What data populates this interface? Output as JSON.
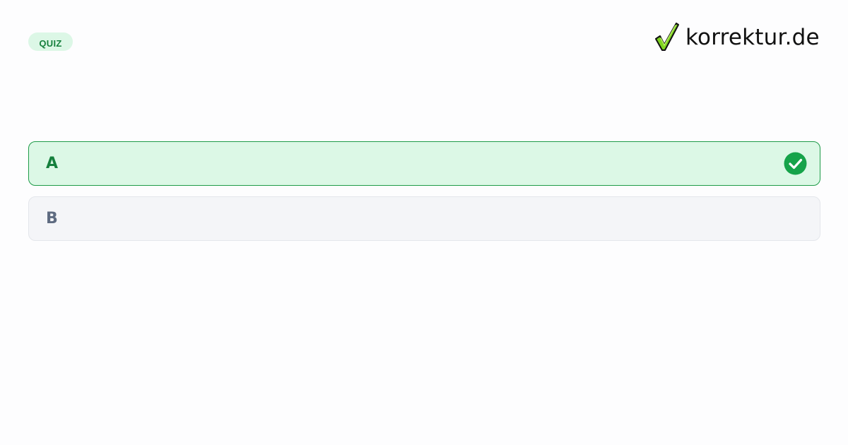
{
  "badge": {
    "label": "QUIZ"
  },
  "brand": {
    "name": "korrektur.de",
    "icon": "checkmark-logo-icon"
  },
  "options": [
    {
      "letter": "A",
      "state": "correct",
      "icon": "check-circle-icon"
    },
    {
      "letter": "B",
      "state": "neutral"
    }
  ],
  "colors": {
    "accent_green": "#16a34a",
    "correct_bg": "#dcf8e6",
    "correct_border": "#1e9b48",
    "neutral_bg": "#f4f5f8",
    "neutral_text": "#5e6b81",
    "badge_bg": "#dcf7e6",
    "logo_check": "#7ed321"
  }
}
